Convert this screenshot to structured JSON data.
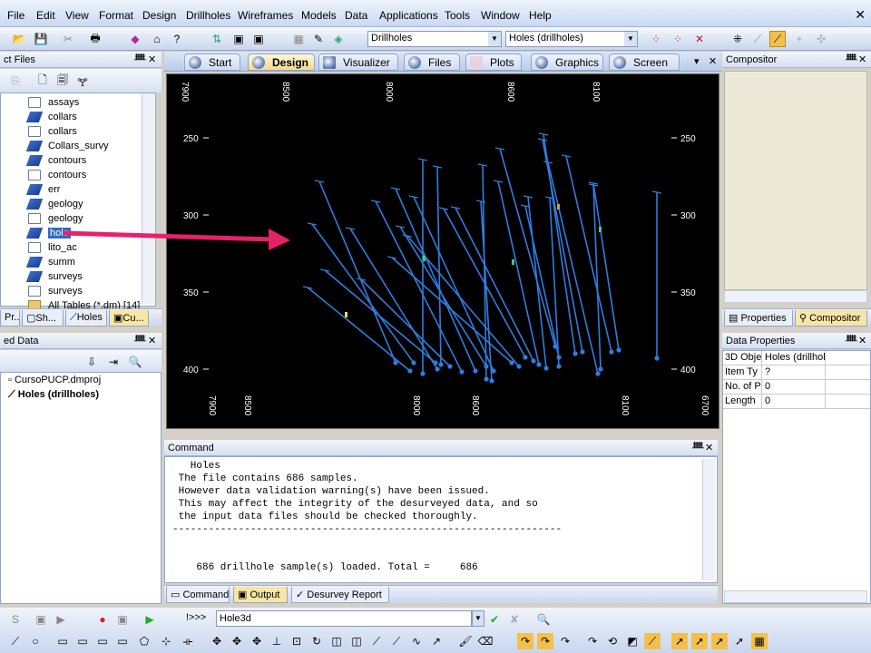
{
  "menu": [
    "File",
    "Edit",
    "View",
    "Format",
    "Design",
    "Drillholes",
    "Wireframes",
    "Models",
    "Data",
    "Applications",
    "Tools",
    "Window",
    "Help"
  ],
  "toolbar": {
    "combo_object": "Drillholes",
    "combo_file": "Holes (drillholes)"
  },
  "project_files": {
    "title": "ct Files",
    "items": [
      {
        "label": "assays",
        "icon": "table-doc-icon"
      },
      {
        "label": "collars",
        "icon": "layer-icon"
      },
      {
        "label": "collars",
        "icon": "table-doc-icon"
      },
      {
        "label": "Collars_survy",
        "icon": "layer-icon"
      },
      {
        "label": "contours",
        "icon": "layer-icon"
      },
      {
        "label": "contours",
        "icon": "table-doc-icon"
      },
      {
        "label": "err",
        "icon": "layer-icon"
      },
      {
        "label": "geology",
        "icon": "layer-icon"
      },
      {
        "label": "geology",
        "icon": "table-doc-icon"
      },
      {
        "label": "hole",
        "icon": "layer-icon"
      },
      {
        "label": "lito_ac",
        "icon": "table-doc-icon"
      },
      {
        "label": "summ",
        "icon": "layer-icon"
      },
      {
        "label": "surveys",
        "icon": "layer-icon"
      },
      {
        "label": "surveys",
        "icon": "table-doc-icon"
      },
      {
        "label": "All Tables (*.dm) [14]",
        "icon": "folder-icon"
      }
    ],
    "tabs": [
      "Pr...",
      "Sh...",
      "Holes",
      "Cu..."
    ]
  },
  "loaded_data": {
    "title": "ed Data",
    "items": [
      "CursoPUCP.dmproj",
      "Holes (drillholes)"
    ]
  },
  "doc_tabs": [
    "Start",
    "Design",
    "Visualizer",
    "Files",
    "Plots",
    "Graphics",
    "Screen"
  ],
  "view": {
    "top_labels": [
      "7900",
      "8500",
      "8000",
      "8600",
      "8100"
    ],
    "bottom_labels": [
      "7900",
      "8500",
      "8000",
      "8600",
      "8100",
      "6700"
    ],
    "left_labels": [
      "250",
      "300",
      "350",
      "400"
    ],
    "right_labels": [
      "250",
      "300",
      "350",
      "400"
    ]
  },
  "command": {
    "title": "Command",
    "lines": [
      "   Holes",
      " The file contains 686 samples.",
      " However data validation warning(s) have been issued.",
      " This may affect the integrity of the desurveyed data, and so",
      " the input data files should be checked thoroughly.",
      "-----------------------------------------------------------------",
      "",
      "",
      "    686 drillhole sample(s) loaded. Total =     686"
    ],
    "tabs": [
      "Command",
      "Output",
      "Desurvey Report"
    ]
  },
  "compositor": {
    "title": "Compositor",
    "tabs": [
      "Properties",
      "Compositor"
    ]
  },
  "data_properties": {
    "title": "Data Properties",
    "rows": [
      {
        "name": "3D Obje",
        "value": "Holes (drillhol"
      },
      {
        "name": "Item Ty",
        "value": "?"
      },
      {
        "name": "No. of P",
        "value": "0"
      },
      {
        "name": "Length",
        "value": "0"
      }
    ]
  },
  "bottom": {
    "prompt": "!>>>",
    "command_value": "Hole3d"
  },
  "colors": {
    "drillhole": "#2f7de0",
    "arrow": "#e8206a",
    "accent": "#f4d98a"
  }
}
